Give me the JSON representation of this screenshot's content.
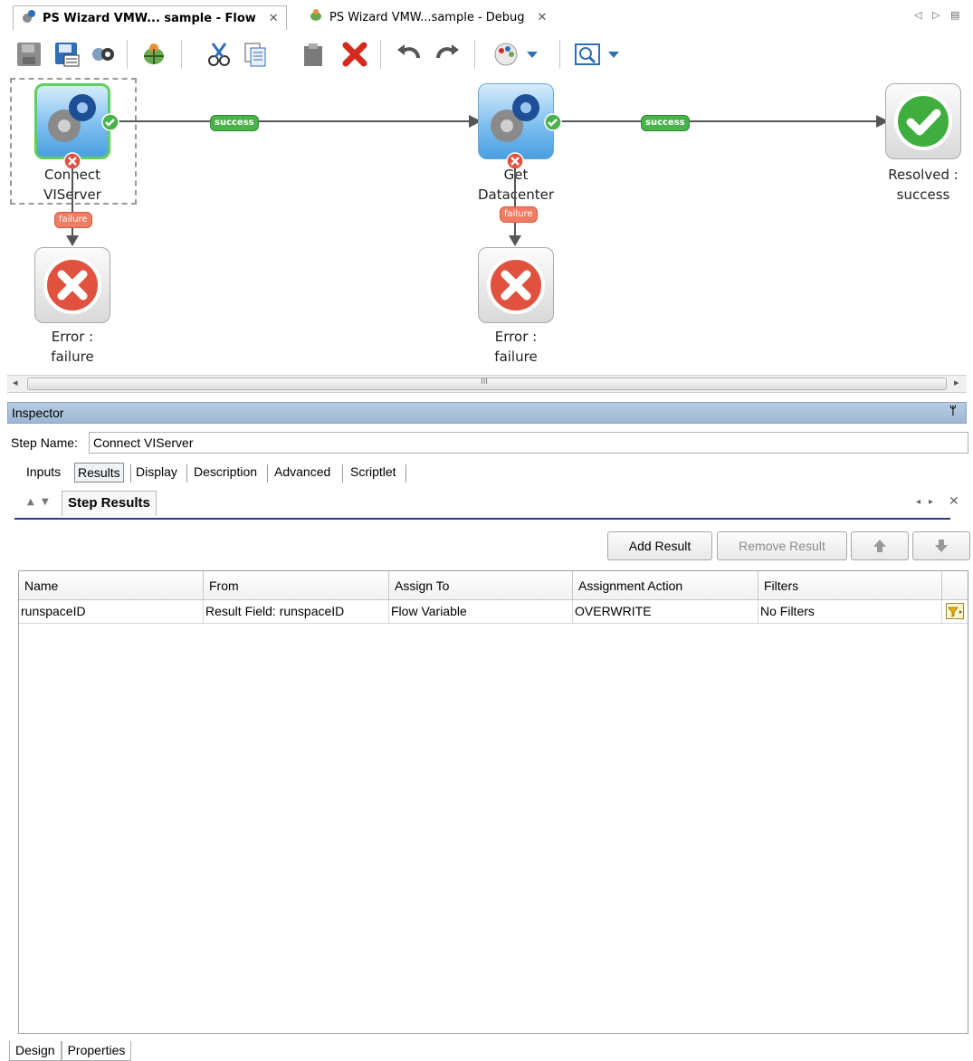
{
  "tabs": [
    {
      "label": "PS Wizard VMW... sample - Flow",
      "active": true
    },
    {
      "label": "PS Wizard VMW...sample - Debug",
      "active": false
    }
  ],
  "toolbar_icons": [
    "save-icon",
    "save-as-icon",
    "link-icon",
    "debug-icon",
    "cut-icon",
    "copy-icon",
    "paste-icon",
    "delete-icon",
    "undo-icon",
    "redo-icon",
    "palette-icon",
    "zoom-icon"
  ],
  "flow": {
    "nodes": {
      "connect": {
        "label1": "Connect",
        "label2": "VIServer"
      },
      "get": {
        "label1": "Get",
        "label2": "Datacenter"
      },
      "resolved": {
        "label1": "Resolved :",
        "label2": "success"
      },
      "error1": {
        "label1": "Error :",
        "label2": "failure"
      },
      "error2": {
        "label1": "Error :",
        "label2": "failure"
      }
    },
    "edges": {
      "success1": "success",
      "success2": "success",
      "failure1": "failure",
      "failure2": "failure"
    }
  },
  "hscroll": {
    "thumb_mark": "III"
  },
  "inspector": {
    "title": "Inspector",
    "pin_glyph": "ᛘ",
    "step_name_label": "Step Name:",
    "step_name_value": "Connect VIServer",
    "tabs": [
      "Inputs",
      "Results",
      "Display",
      "Description",
      "Advanced",
      "Scriptlet"
    ],
    "selected_tab": "Results",
    "subtab": "Step Results",
    "buttons": {
      "add": "Add Result",
      "remove": "Remove Result"
    },
    "table": {
      "columns": [
        "Name",
        "From",
        "Assign To",
        "Assignment Action",
        "Filters"
      ],
      "rows": [
        {
          "name": "runspaceID",
          "from": "Result Field: runspaceID",
          "assign_to": "Flow Variable",
          "action": "OVERWRITE",
          "filters": "No Filters"
        }
      ]
    }
  },
  "bottom_tabs": [
    "Design",
    "Properties"
  ]
}
